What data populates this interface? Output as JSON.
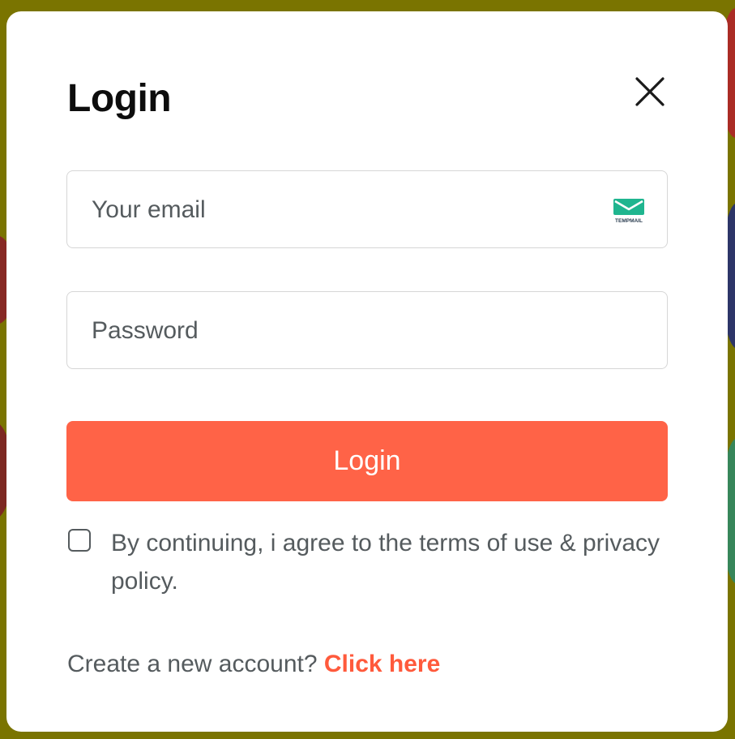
{
  "modal": {
    "title": "Login",
    "close_icon": "close-icon"
  },
  "form": {
    "email_placeholder": "Your email",
    "email_icon": "tempmail-envelope-icon",
    "email_icon_caption": "TEMPMAIL",
    "password_placeholder": "Password",
    "login_button_label": "Login",
    "agree_checked": false,
    "agree_text": "By continuing, i agree to the terms of use & privacy policy."
  },
  "footer": {
    "create_prompt": "Create a new account?",
    "create_link": "Click here"
  },
  "colors": {
    "accent": "#ff6347",
    "link": "#ff5a3c",
    "tempmail_green": "#1fb58f"
  }
}
